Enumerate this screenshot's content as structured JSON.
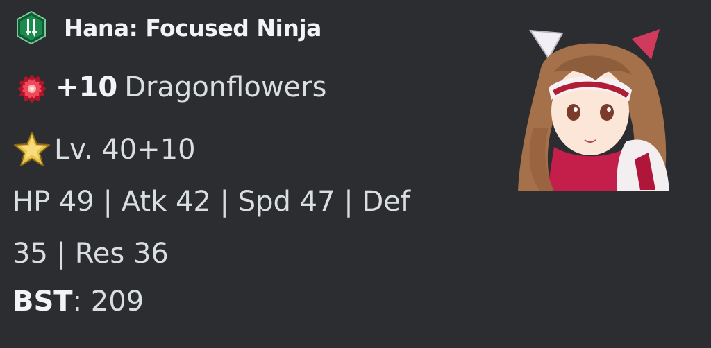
{
  "hero": {
    "name": "Hana: Focused Ninja",
    "weapon_icon": "green-dagger-icon"
  },
  "merges": {
    "value": "+10",
    "label": "Dragonflowers",
    "icon": "dragonflower-icon"
  },
  "level": {
    "text": "Lv. 40+10",
    "icon": "star-icon"
  },
  "stats": {
    "line1": "HP 49 | Atk 42 | Spd 47 | Def",
    "line2": "35 | Res 36"
  },
  "bst": {
    "label": "BST",
    "separator": ":",
    "value": " 209"
  },
  "portrait": {
    "icon": "hero-portrait"
  },
  "colors": {
    "background": "#2b2d31",
    "text": "#dbdee1",
    "title": "#f2f3f5",
    "weapon_green": "#1c8a4e",
    "flower_red": "#d6283b",
    "star_gold": "#d9b441"
  }
}
